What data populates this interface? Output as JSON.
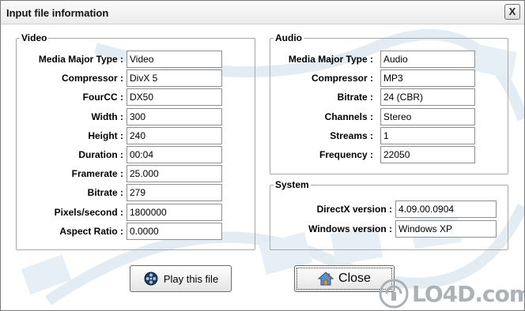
{
  "window": {
    "title": "Input file information",
    "close_glyph": "X"
  },
  "video": {
    "legend": "Video",
    "rows": [
      {
        "label": "Media Major Type :",
        "value": "Video"
      },
      {
        "label": "Compressor :",
        "value": "DivX 5"
      },
      {
        "label": "FourCC :",
        "value": "DX50"
      },
      {
        "label": "Width :",
        "value": "300"
      },
      {
        "label": "Height :",
        "value": "240"
      },
      {
        "label": "Duration :",
        "value": "00:04"
      },
      {
        "label": "Framerate :",
        "value": "25.000"
      },
      {
        "label": "Bitrate :",
        "value": "279"
      },
      {
        "label": "Pixels/second :",
        "value": "1800000"
      },
      {
        "label": "Aspect Ratio :",
        "value": "0.0000"
      }
    ]
  },
  "audio": {
    "legend": "Audio",
    "rows": [
      {
        "label": "Media Major Type :",
        "value": "Audio"
      },
      {
        "label": "Compressor :",
        "value": "MP3"
      },
      {
        "label": "Bitrate :",
        "value": "24 (CBR)"
      },
      {
        "label": "Channels :",
        "value": "Stereo"
      },
      {
        "label": "Streams :",
        "value": "1"
      },
      {
        "label": "Frequency :",
        "value": "22050"
      }
    ]
  },
  "system": {
    "legend": "System",
    "rows": [
      {
        "label": "DirectX version :",
        "value": "4.09.00.0904"
      },
      {
        "label": "Windows version :",
        "value": "Windows XP"
      }
    ]
  },
  "buttons": {
    "play": "Play this file",
    "close": "Close"
  },
  "icons": {
    "play": "film-reel-icon",
    "close": "house-icon"
  },
  "watermark": {
    "text": "LO4D.com"
  },
  "colors": {
    "background": "#ffffff",
    "art": "#e8f1f6",
    "watermark": "#9ea6ac"
  }
}
